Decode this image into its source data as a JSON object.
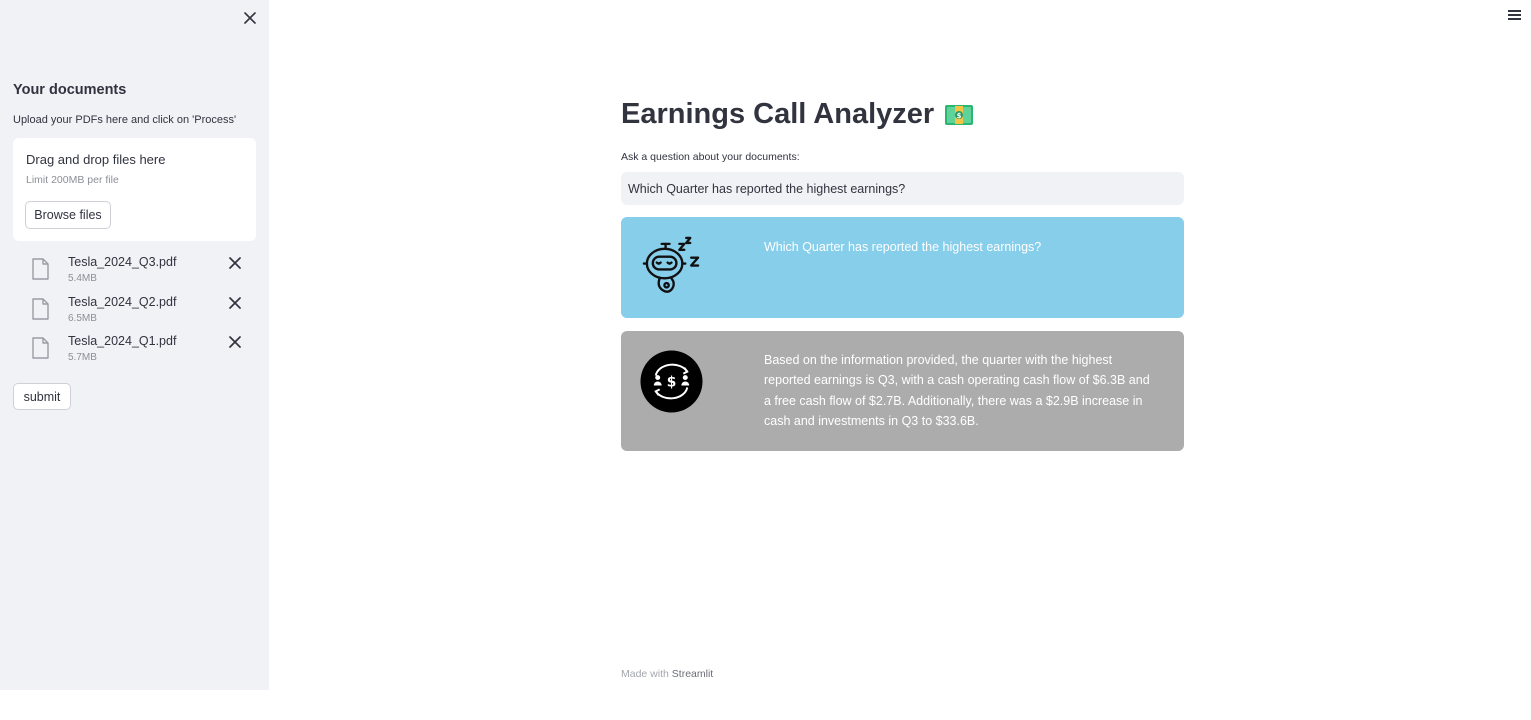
{
  "sidebar": {
    "title": "Your documents",
    "subtitle": "Upload your PDFs here and click on 'Process'",
    "dropzone": {
      "title": "Drag and drop files here",
      "limit": "Limit 200MB per file",
      "browse_label": "Browse files"
    },
    "files": [
      {
        "name": "Tesla_2024_Q3.pdf",
        "size": "5.4MB"
      },
      {
        "name": "Tesla_2024_Q2.pdf",
        "size": "6.5MB"
      },
      {
        "name": "Tesla_2024_Q1.pdf",
        "size": "5.7MB"
      }
    ],
    "submit_label": "submit"
  },
  "main": {
    "title": "Earnings Call Analyzer",
    "question_label": "Ask a question about your documents:",
    "question_value": "Which Quarter has reported the highest earnings?",
    "messages": [
      {
        "role": "user",
        "text": "Which Quarter has reported the highest earnings?"
      },
      {
        "role": "bot",
        "text": "Based on the information provided, the quarter with the highest reported earnings is Q3, with a cash operating cash flow of $6.3B and a free cash flow of $2.7B. Additionally, there was a $2.9B increase in cash and investments in Q3 to $33.6B."
      }
    ]
  },
  "footer": {
    "prefix": "Made with",
    "brand": "Streamlit"
  },
  "colors": {
    "sidebar_bg": "#f0f2f6",
    "user_msg_bg": "#87ceeb",
    "bot_msg_bg": "#acacac"
  }
}
